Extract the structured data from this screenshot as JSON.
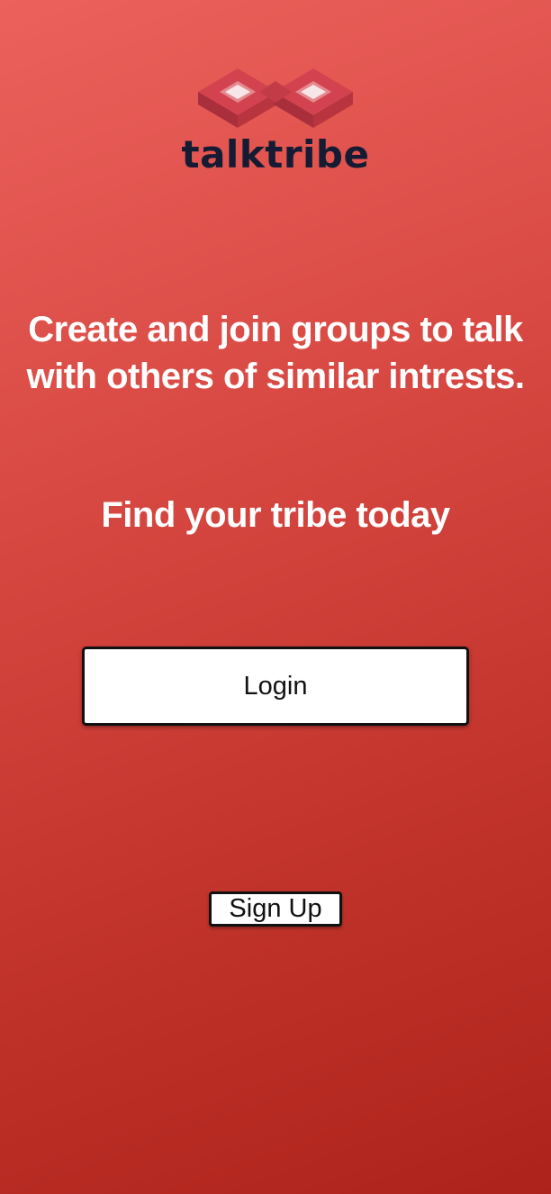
{
  "brand": {
    "logo_icon": "infinity-cube-logo-icon",
    "name": "talktribe",
    "colors": {
      "logo_red": "#cc3f4c",
      "logo_dark": "#151b33"
    }
  },
  "hero": {
    "tagline": "Create and join groups to talk with others of similar intrests.",
    "subtitle": "Find your tribe today"
  },
  "actions": {
    "login_label": "Login",
    "signup_label": "Sign Up"
  },
  "theme": {
    "background_top": "#ec615c",
    "background_bottom": "#ad231b",
    "text": "#ffffff",
    "button_bg": "#ffffff",
    "button_border": "#111111"
  }
}
